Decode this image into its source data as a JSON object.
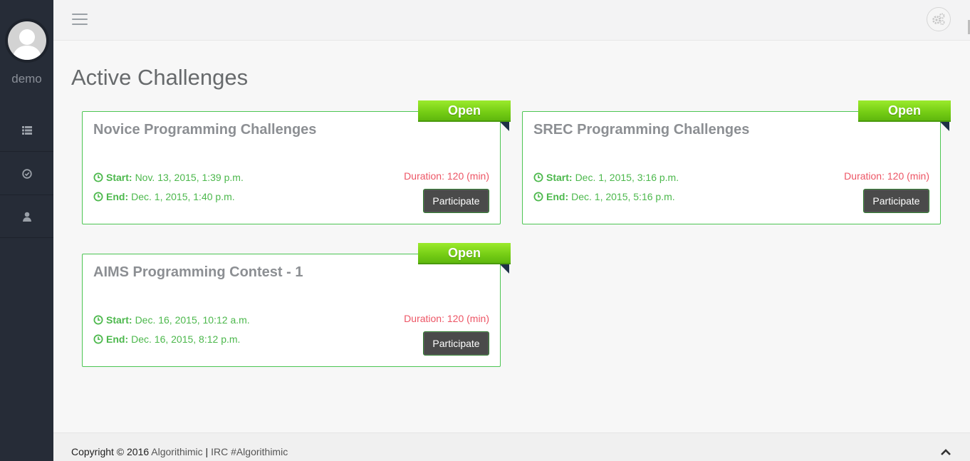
{
  "sidebar": {
    "username": "demo",
    "nav": [
      {
        "icon": "list-icon"
      },
      {
        "icon": "check-circle-icon"
      },
      {
        "icon": "user-icon"
      }
    ]
  },
  "topbar": {
    "menu_icon": "hamburger-icon",
    "settings_icon": "gears-icon"
  },
  "page": {
    "title": "Active Challenges"
  },
  "challenges": [
    {
      "title": "Novice Programming Challenges",
      "status": "Open",
      "start_label": "Start:",
      "start": "Nov. 13, 2015, 1:39 p.m.",
      "end_label": "End:",
      "end": "Dec. 1, 2015, 1:40 p.m.",
      "duration": "Duration: 120 (min)",
      "button": "Participate"
    },
    {
      "title": "SREC Programming Challenges",
      "status": "Open",
      "start_label": "Start:",
      "start": "Dec. 1, 2015, 3:16 p.m.",
      "end_label": "End:",
      "end": "Dec. 1, 2015, 5:16 p.m.",
      "duration": "Duration: 120 (min)",
      "button": "Participate"
    },
    {
      "title": "AIMS Programming Contest - 1",
      "status": "Open",
      "start_label": "Start:",
      "start": "Dec. 16, 2015, 10:12 a.m.",
      "end_label": "End:",
      "end": "Dec. 16, 2015, 8:12 p.m.",
      "duration": "Duration: 120 (min)",
      "button": "Participate"
    }
  ],
  "footer": {
    "copyright": "Copyright © 2016",
    "brand": "Algorithimic",
    "separator": "|",
    "irc": "IRC #Algorithimic"
  },
  "colors": {
    "sidebar_bg": "#262c37",
    "accent_green": "#4cc552",
    "duration_red": "#ed5565",
    "ribbon_green": "#74cc14"
  }
}
